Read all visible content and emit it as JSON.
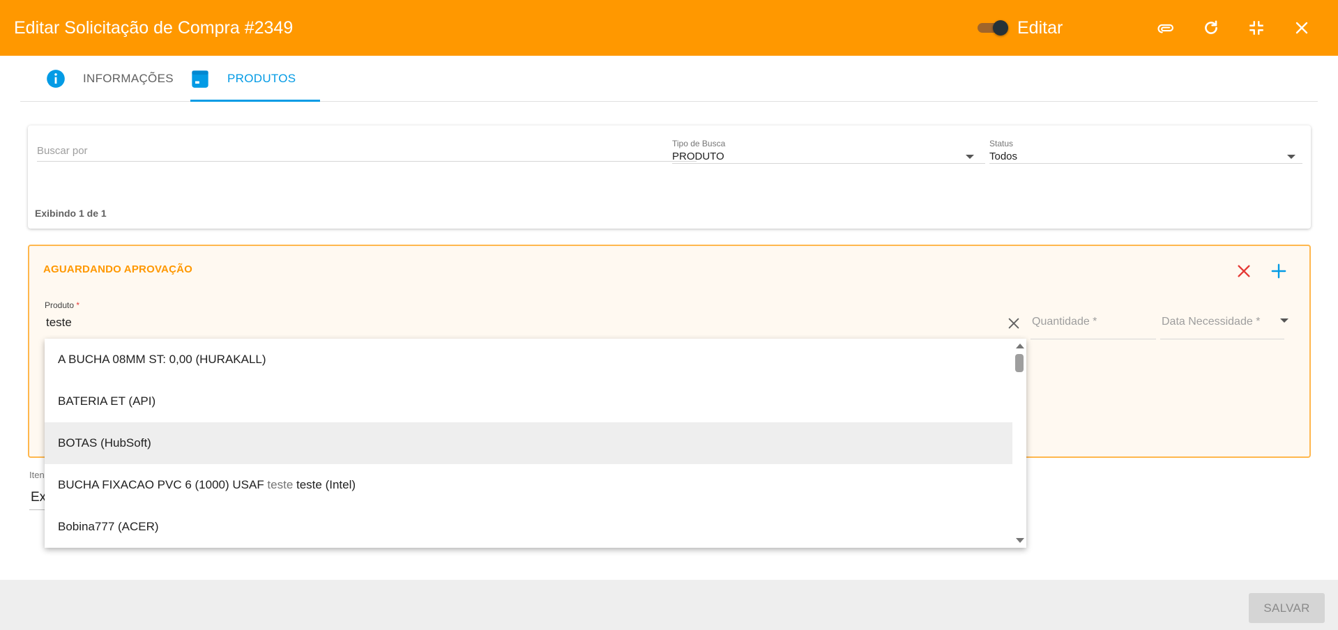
{
  "header": {
    "title": "Editar Solicitação de Compra #2349",
    "toggle_label": "Editar",
    "toggle_on": true,
    "color": "#ff9800"
  },
  "tabs": [
    {
      "label": "INFORMAÇÕES",
      "icon": "info-icon",
      "active": false
    },
    {
      "label": "PRODUTOS",
      "icon": "shopping-bag-icon",
      "active": true
    }
  ],
  "search": {
    "buscar_placeholder": "Buscar por",
    "tipo_label": "Tipo de Busca",
    "tipo_value": "PRODUTO",
    "status_label": "Status",
    "status_value": "Todos",
    "count_text": "Exibindo 1 de 1"
  },
  "product_card": {
    "status": "AGUARDANDO APROVAÇÃO",
    "produto_label": "Produto",
    "required_mark": "*",
    "produto_value": "teste",
    "quantidade_placeholder": "Quantidade *",
    "data_placeholder": "Data Necessidade *"
  },
  "itens": {
    "label": "Iten",
    "value": "Ex"
  },
  "dropdown": {
    "items": [
      {
        "pre": "A BUCHA 08MM ST: 0,00 (HURAKALL)",
        "muted": "",
        "post": ""
      },
      {
        "pre": "BATERIA ET (API)",
        "muted": "",
        "post": ""
      },
      {
        "pre": "BOTAS (HubSoft)",
        "muted": "",
        "post": ""
      },
      {
        "pre": "BUCHA FIXACAO PVC 6 (1000) USAF ",
        "muted": "teste",
        "post": " teste (Intel)"
      },
      {
        "pre": "Bobina777 (ACER)",
        "muted": "",
        "post": ""
      }
    ],
    "highlighted_index": 2
  },
  "footer": {
    "save_label": "SALVAR"
  },
  "colors": {
    "accent": "#ff9800",
    "tab_active": "#039be5",
    "danger": "#e53935"
  }
}
